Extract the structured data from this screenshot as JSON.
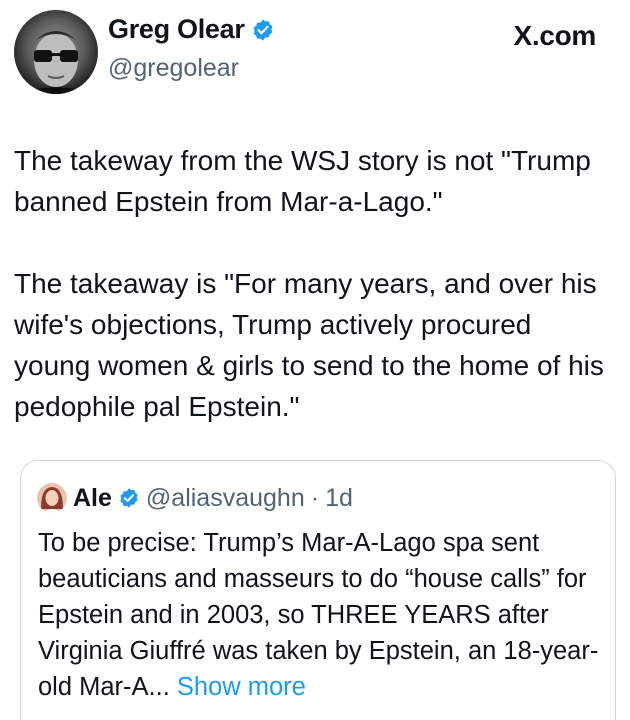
{
  "author": {
    "display_name": "Greg Olear",
    "handle": "@gregolear",
    "avatar_icon": "avatar-photo",
    "verified_icon": "verified-badge-icon"
  },
  "platform": "X.com",
  "tweet": {
    "paragraphs": [
      "The takeway from the WSJ story is not \"Trump banned Epstein from Mar-a-Lago.\"",
      "The takeaway is \"For many years, and over his wife's objections, Trump actively procured young women & girls to send to the home of his pedophile pal Epstein.\""
    ]
  },
  "quote": {
    "display_name": "Ale",
    "handle": "@aliasvaughn",
    "separator": "·",
    "time": "1d",
    "text": "To be precise: Trump’s Mar-A-Lago spa sent beauticians and masseurs to do “house calls” for Epstein and in 2003, so THREE YEARS after Virginia Giuffré was taken by Epstein, an 18-year-old Mar-A...",
    "show_more": " Show more"
  },
  "colors": {
    "text": "#0f1419",
    "secondary": "#536471",
    "link": "#1d9bf0",
    "verified": "#1d9bf0",
    "border": "#cfd9de"
  }
}
